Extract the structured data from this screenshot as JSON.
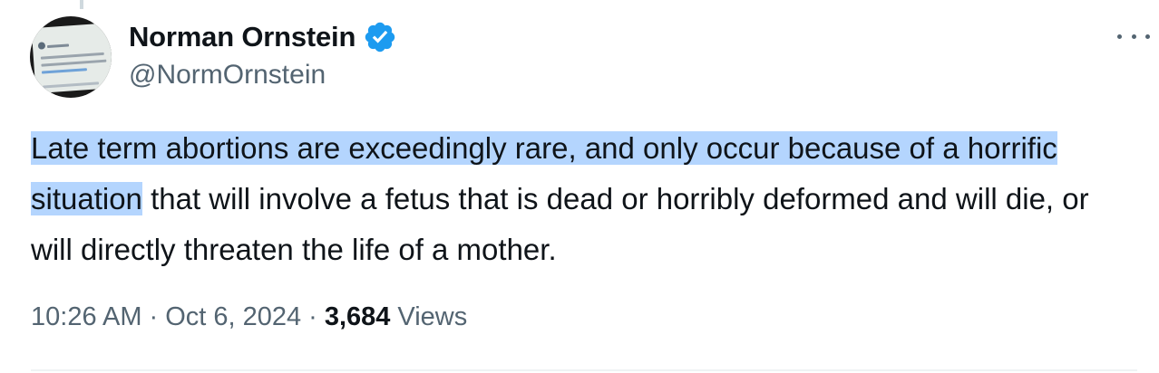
{
  "author": {
    "display_name": "Norman Ornstein",
    "handle": "@NormOrnstein",
    "verified": true
  },
  "tweet": {
    "text_highlighted": "Late term abortions are exceedingly rare, and only occur because of a horrific situation",
    "text_rest": " that will involve a fetus that is dead or horribly deformed and will die, or will directly threaten the life of a mother."
  },
  "meta": {
    "time": "10:26 AM",
    "separator": "·",
    "date": "Oct 6, 2024",
    "views_count": "3,684",
    "views_label": "Views"
  },
  "icons": {
    "verified": "verified-badge-icon",
    "more": "more-options-icon"
  },
  "colors": {
    "verified_blue": "#1d9bf0",
    "selection_highlight": "#b4d5fe",
    "secondary_text": "#536471",
    "primary_text": "#0f1419"
  }
}
